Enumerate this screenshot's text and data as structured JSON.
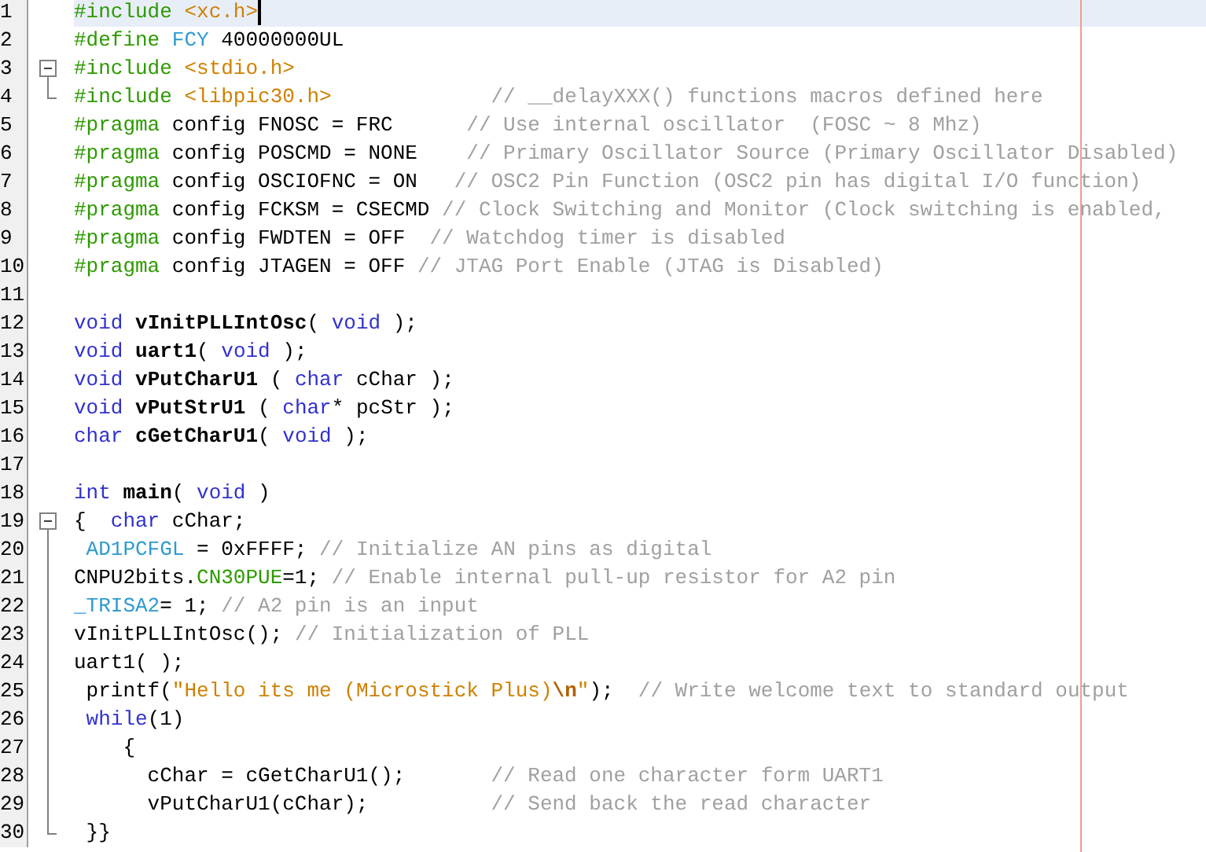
{
  "editor": {
    "lines": [
      {
        "number": "1",
        "current": true,
        "fold_start": false,
        "in_fold": false,
        "fold_end": false,
        "tokens": [
          {
            "text": "#include ",
            "kind": "pre"
          },
          {
            "text": "<xc.h>",
            "kind": "include"
          }
        ]
      },
      {
        "number": "2",
        "current": false,
        "fold_start": false,
        "in_fold": false,
        "fold_end": false,
        "tokens": [
          {
            "text": "#define ",
            "kind": "pre"
          },
          {
            "text": "FCY",
            "kind": "macro"
          },
          {
            "text": " 40000000UL",
            "kind": "plain"
          }
        ]
      },
      {
        "number": "3",
        "current": false,
        "fold_start": true,
        "in_fold": false,
        "fold_end": false,
        "tokens": [
          {
            "text": "#include ",
            "kind": "pre"
          },
          {
            "text": "<stdio.h>",
            "kind": "include"
          }
        ]
      },
      {
        "number": "4",
        "current": false,
        "fold_start": false,
        "in_fold": false,
        "fold_end": true,
        "tokens": [
          {
            "text": "#include ",
            "kind": "pre"
          },
          {
            "text": "<libpic30.h>",
            "kind": "include"
          },
          {
            "text": "             // __delayXXX() functions macros defined here",
            "kind": "comment"
          }
        ]
      },
      {
        "number": "5",
        "current": false,
        "fold_start": false,
        "in_fold": false,
        "fold_end": false,
        "tokens": [
          {
            "text": "#pragma",
            "kind": "pre"
          },
          {
            "text": " config FNOSC = FRC      ",
            "kind": "plain"
          },
          {
            "text": "// Use internal oscillator  (FOSC ~ 8 Mhz)",
            "kind": "comment"
          }
        ]
      },
      {
        "number": "6",
        "current": false,
        "fold_start": false,
        "in_fold": false,
        "fold_end": false,
        "tokens": [
          {
            "text": "#pragma",
            "kind": "pre"
          },
          {
            "text": " config POSCMD = NONE    ",
            "kind": "plain"
          },
          {
            "text": "// Primary Oscillator Source (Primary Oscillator Disabled)",
            "kind": "comment"
          }
        ]
      },
      {
        "number": "7",
        "current": false,
        "fold_start": false,
        "in_fold": false,
        "fold_end": false,
        "tokens": [
          {
            "text": "#pragma",
            "kind": "pre"
          },
          {
            "text": " config OSCIOFNC = ON   ",
            "kind": "plain"
          },
          {
            "text": "// OSC2 Pin Function (OSC2 pin has digital I/O function)",
            "kind": "comment"
          }
        ]
      },
      {
        "number": "8",
        "current": false,
        "fold_start": false,
        "in_fold": false,
        "fold_end": false,
        "tokens": [
          {
            "text": "#pragma",
            "kind": "pre"
          },
          {
            "text": " config FCKSM = CSECMD ",
            "kind": "plain"
          },
          {
            "text": "// Clock Switching and Monitor (Clock switching is enabled,",
            "kind": "comment"
          }
        ]
      },
      {
        "number": "9",
        "current": false,
        "fold_start": false,
        "in_fold": false,
        "fold_end": false,
        "tokens": [
          {
            "text": "#pragma",
            "kind": "pre"
          },
          {
            "text": " config FWDTEN = OFF  ",
            "kind": "plain"
          },
          {
            "text": "// Watchdog timer is disabled",
            "kind": "comment"
          }
        ]
      },
      {
        "number": "10",
        "current": false,
        "fold_start": false,
        "in_fold": false,
        "fold_end": false,
        "tokens": [
          {
            "text": "#pragma",
            "kind": "pre"
          },
          {
            "text": " config JTAGEN = OFF ",
            "kind": "plain"
          },
          {
            "text": "// JTAG Port Enable (JTAG is Disabled)",
            "kind": "comment"
          }
        ]
      },
      {
        "number": "11",
        "current": false,
        "fold_start": false,
        "in_fold": false,
        "fold_end": false
      },
      {
        "number": "12",
        "current": false,
        "fold_start": false,
        "in_fold": false,
        "fold_end": false,
        "tokens": [
          {
            "text": "void",
            "kind": "keyword"
          },
          {
            "text": " vInitPLLIntOsc",
            "kind": "func"
          },
          {
            "text": "( ",
            "kind": "plain"
          },
          {
            "text": "void",
            "kind": "keyword"
          },
          {
            "text": " );",
            "kind": "plain"
          }
        ]
      },
      {
        "number": "13",
        "current": false,
        "fold_start": false,
        "in_fold": false,
        "fold_end": false,
        "tokens": [
          {
            "text": "void",
            "kind": "keyword"
          },
          {
            "text": " uart1",
            "kind": "func"
          },
          {
            "text": "( ",
            "kind": "plain"
          },
          {
            "text": "void",
            "kind": "keyword"
          },
          {
            "text": " );",
            "kind": "plain"
          }
        ]
      },
      {
        "number": "14",
        "current": false,
        "fold_start": false,
        "in_fold": false,
        "fold_end": false,
        "tokens": [
          {
            "text": "void",
            "kind": "keyword"
          },
          {
            "text": " vPutCharU1",
            "kind": "func"
          },
          {
            "text": " ( ",
            "kind": "plain"
          },
          {
            "text": "char",
            "kind": "keyword"
          },
          {
            "text": " cChar );",
            "kind": "plain"
          }
        ]
      },
      {
        "number": "15",
        "current": false,
        "fold_start": false,
        "in_fold": false,
        "fold_end": false,
        "tokens": [
          {
            "text": "void",
            "kind": "keyword"
          },
          {
            "text": " vPutStrU1",
            "kind": "func"
          },
          {
            "text": " ( ",
            "kind": "plain"
          },
          {
            "text": "char",
            "kind": "keyword"
          },
          {
            "text": "* pcStr );",
            "kind": "plain"
          }
        ]
      },
      {
        "number": "16",
        "current": false,
        "fold_start": false,
        "in_fold": false,
        "fold_end": false,
        "tokens": [
          {
            "text": "char",
            "kind": "keyword"
          },
          {
            "text": " cGetCharU1",
            "kind": "func"
          },
          {
            "text": "( ",
            "kind": "plain"
          },
          {
            "text": "void",
            "kind": "keyword"
          },
          {
            "text": " );",
            "kind": "plain"
          }
        ]
      },
      {
        "number": "17",
        "current": false,
        "fold_start": false,
        "in_fold": false,
        "fold_end": false
      },
      {
        "number": "18",
        "current": false,
        "fold_start": false,
        "in_fold": false,
        "fold_end": false,
        "tokens": [
          {
            "text": "int",
            "kind": "keyword"
          },
          {
            "text": " main",
            "kind": "func"
          },
          {
            "text": "( ",
            "kind": "plain"
          },
          {
            "text": "void",
            "kind": "keyword"
          },
          {
            "text": " )",
            "kind": "plain"
          }
        ]
      },
      {
        "number": "19",
        "current": false,
        "fold_start": true,
        "in_fold": false,
        "fold_end": false,
        "tokens": [
          {
            "text": "{  ",
            "kind": "plain"
          },
          {
            "text": "char",
            "kind": "keyword"
          },
          {
            "text": " cChar;",
            "kind": "plain"
          }
        ]
      },
      {
        "number": "20",
        "current": false,
        "fold_start": false,
        "in_fold": true,
        "fold_end": false,
        "tokens": [
          {
            "text": " AD1PCFGL",
            "kind": "sfr"
          },
          {
            "text": " = 0xFFFF; ",
            "kind": "plain"
          },
          {
            "text": "// Initialize AN pins as digital",
            "kind": "comment"
          }
        ]
      },
      {
        "number": "21",
        "current": false,
        "fold_start": false,
        "in_fold": true,
        "fold_end": false,
        "tokens": [
          {
            "text": "CNPU2bits.",
            "kind": "plain"
          },
          {
            "text": "CN30PUE",
            "kind": "field"
          },
          {
            "text": "=1; ",
            "kind": "plain"
          },
          {
            "text": "// Enable internal pull-up resistor for A2 pin",
            "kind": "comment"
          }
        ]
      },
      {
        "number": "22",
        "current": false,
        "fold_start": false,
        "in_fold": true,
        "fold_end": false,
        "tokens": [
          {
            "text": "_TRISA2",
            "kind": "sfr"
          },
          {
            "text": "= 1; ",
            "kind": "plain"
          },
          {
            "text": "// A2 pin is an input",
            "kind": "comment"
          }
        ]
      },
      {
        "number": "23",
        "current": false,
        "fold_start": false,
        "in_fold": true,
        "fold_end": false,
        "tokens": [
          {
            "text": "vInitPLLIntOsc(); ",
            "kind": "plain"
          },
          {
            "text": "// Initialization of PLL",
            "kind": "comment"
          }
        ]
      },
      {
        "number": "24",
        "current": false,
        "fold_start": false,
        "in_fold": true,
        "fold_end": false,
        "tokens": [
          {
            "text": "uart1( );",
            "kind": "plain"
          }
        ]
      },
      {
        "number": "25",
        "current": false,
        "fold_start": false,
        "in_fold": true,
        "fold_end": false,
        "tokens": [
          {
            "text": " printf(",
            "kind": "plain"
          },
          {
            "text": "\"Hello its me (Microstick Plus)",
            "kind": "string"
          },
          {
            "text": "\\n",
            "kind": "escape"
          },
          {
            "text": "\"",
            "kind": "string"
          },
          {
            "text": ");  ",
            "kind": "plain"
          },
          {
            "text": "// Write welcome text to standard output",
            "kind": "comment"
          }
        ]
      },
      {
        "number": "26",
        "current": false,
        "fold_start": false,
        "in_fold": true,
        "fold_end": false,
        "tokens": [
          {
            "text": " while",
            "kind": "keyword"
          },
          {
            "text": "(1)",
            "kind": "plain"
          }
        ]
      },
      {
        "number": "27",
        "current": false,
        "fold_start": false,
        "in_fold": true,
        "fold_end": false,
        "tokens": [
          {
            "text": "    {",
            "kind": "plain"
          }
        ]
      },
      {
        "number": "28",
        "current": false,
        "fold_start": false,
        "in_fold": true,
        "fold_end": false,
        "tokens": [
          {
            "text": "      cChar = cGetCharU1();       ",
            "kind": "plain"
          },
          {
            "text": "// Read one character form UART1",
            "kind": "comment"
          }
        ]
      },
      {
        "number": "29",
        "current": false,
        "fold_start": false,
        "in_fold": true,
        "fold_end": false,
        "tokens": [
          {
            "text": "      vPutCharU1(cChar);          ",
            "kind": "plain"
          },
          {
            "text": "// Send back the read character",
            "kind": "comment"
          }
        ]
      },
      {
        "number": "30",
        "current": false,
        "fold_start": false,
        "in_fold": false,
        "fold_end": true,
        "tokens": [
          {
            "text": " }}",
            "kind": "plain"
          }
        ]
      }
    ]
  }
}
